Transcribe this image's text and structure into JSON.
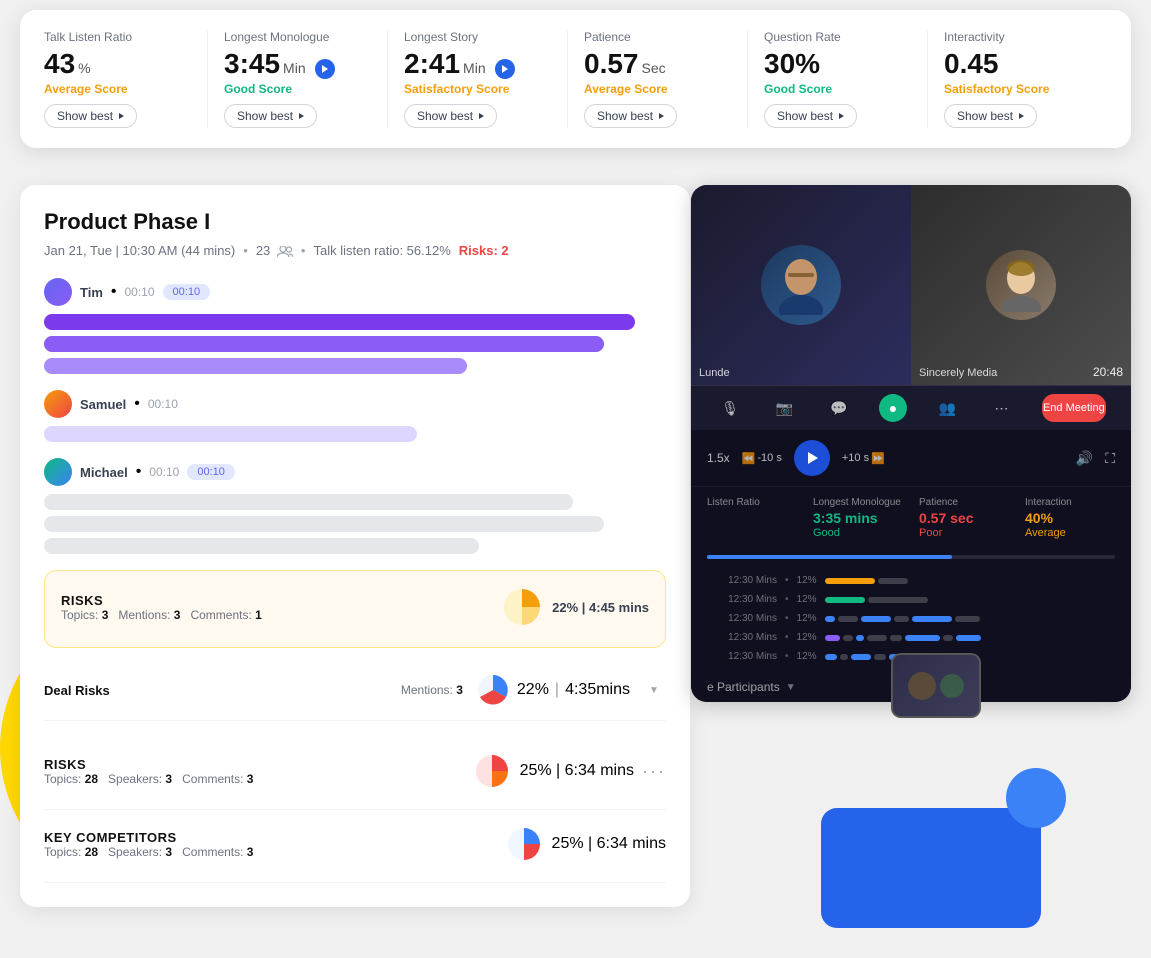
{
  "metrics": [
    {
      "id": "talk-listen",
      "label": "Talk Listen Ratio",
      "value": "43",
      "unit": "%",
      "has_play": false,
      "score_label": "Average Score",
      "score_class": "score-avg",
      "show_best": "Show best"
    },
    {
      "id": "longest-monologue",
      "label": "Longest Monologue",
      "value": "3:45",
      "unit": "Min",
      "has_play": true,
      "score_label": "Good Score",
      "score_class": "score-good",
      "show_best": "Show best"
    },
    {
      "id": "longest-story",
      "label": "Longest Story",
      "value": "2:41",
      "unit": "Min",
      "has_play": true,
      "score_label": "Satisfactory Score",
      "score_class": "score-satisfactory",
      "show_best": "Show best"
    },
    {
      "id": "patience",
      "label": "Patience",
      "value": "0.57",
      "unit": "Sec",
      "has_play": false,
      "score_label": "Average Score",
      "score_class": "score-avg",
      "show_best": "Show best"
    },
    {
      "id": "question-rate",
      "label": "Question Rate",
      "value": "30%",
      "unit": "",
      "has_play": false,
      "score_label": "Good Score",
      "score_class": "score-good",
      "show_best": "Show best"
    },
    {
      "id": "interactivity",
      "label": "Interactivity",
      "value": "0.45",
      "unit": "",
      "has_play": false,
      "score_label": "Satisfactory Score",
      "score_class": "score-satisfactory",
      "show_best": "Show best"
    }
  ],
  "panel": {
    "title": "Product Phase I",
    "date": "Jan 21, Tue | 10:30 AM (44 mins)",
    "attendees": "23",
    "talk_ratio": "Talk listen ratio: 56.12%",
    "risks_badge": "Risks: 2"
  },
  "participants": [
    {
      "name": "Tim",
      "time_start": "00:10",
      "bubble": "00:10",
      "bars": [
        "bar-purple-1",
        "bar-purple-2",
        "bar-purple-3"
      ]
    },
    {
      "name": "Samuel",
      "time_start": "00:10",
      "bubble": null,
      "bars": [
        "bar-lavender-1"
      ]
    },
    {
      "name": "Michael",
      "time_start": "00:10",
      "bubble": "00:10",
      "bars": [
        "bar-gray-1",
        "bar-gray-2",
        "bar-gray-3"
      ]
    }
  ],
  "risks_section": {
    "title": "RISKS",
    "topics": "3",
    "mentions": "3",
    "comments": "1",
    "percentage": "22%",
    "duration": "4:45 mins"
  },
  "deal_risks": {
    "label": "Deal Risks",
    "mentions": "3",
    "percentage": "22%",
    "duration": "4:35mins"
  },
  "risks_section2": {
    "title": "RISKS",
    "topics": "28",
    "speakers": "3",
    "comments": "3",
    "percentage": "25%",
    "duration": "6:34 mins",
    "dots": "···"
  },
  "key_competitors": {
    "title": "KEY COMPETITORS",
    "topics": "28",
    "speakers": "3",
    "comments": "3",
    "percentage": "25%",
    "duration": "6:34 mins"
  },
  "video": {
    "timestamp": "20:48",
    "left_label": "Lunde",
    "right_label": "Sincerely Media",
    "speed": "1.5x",
    "skip_back": "-10 s",
    "skip_forward": "+10 s",
    "stats": [
      {
        "label": "Listen Ratio",
        "value": "",
        "display": ""
      },
      {
        "label": "Longest Monologue",
        "value": "3:35 mins",
        "quality": "Good",
        "value_class": "green",
        "quality_class": "good"
      },
      {
        "label": "Patience",
        "value": "0.57 sec",
        "quality": "Poor",
        "value_class": "red",
        "quality_class": "poor"
      },
      {
        "label": "Interaction",
        "value": "40%",
        "quality": "Average",
        "value_class": "yellow",
        "quality_class": "avg"
      }
    ],
    "timeline_rows": [
      {
        "label": "12:30 Mins",
        "pct": "12%",
        "bars": [
          "orange",
          "gray",
          "gray"
        ]
      },
      {
        "label": "12:30 Mins",
        "pct": "12%",
        "bars": [
          "green",
          "gray",
          "gray"
        ]
      },
      {
        "label": "12:30 Mins",
        "pct": "12%",
        "bars": [
          "blue",
          "gray",
          "blue",
          "gray",
          "blue"
        ]
      },
      {
        "label": "12:30 Mins",
        "pct": "12%",
        "bars": [
          "purple",
          "gray",
          "blue",
          "gray",
          "gray",
          "blue",
          "gray"
        ]
      },
      {
        "label": "12:30 Mins",
        "pct": "12%",
        "bars": [
          "blue",
          "gray",
          "blue",
          "gray",
          "blue",
          "gray",
          "blue"
        ]
      }
    ],
    "participants_label": "e Participants"
  }
}
